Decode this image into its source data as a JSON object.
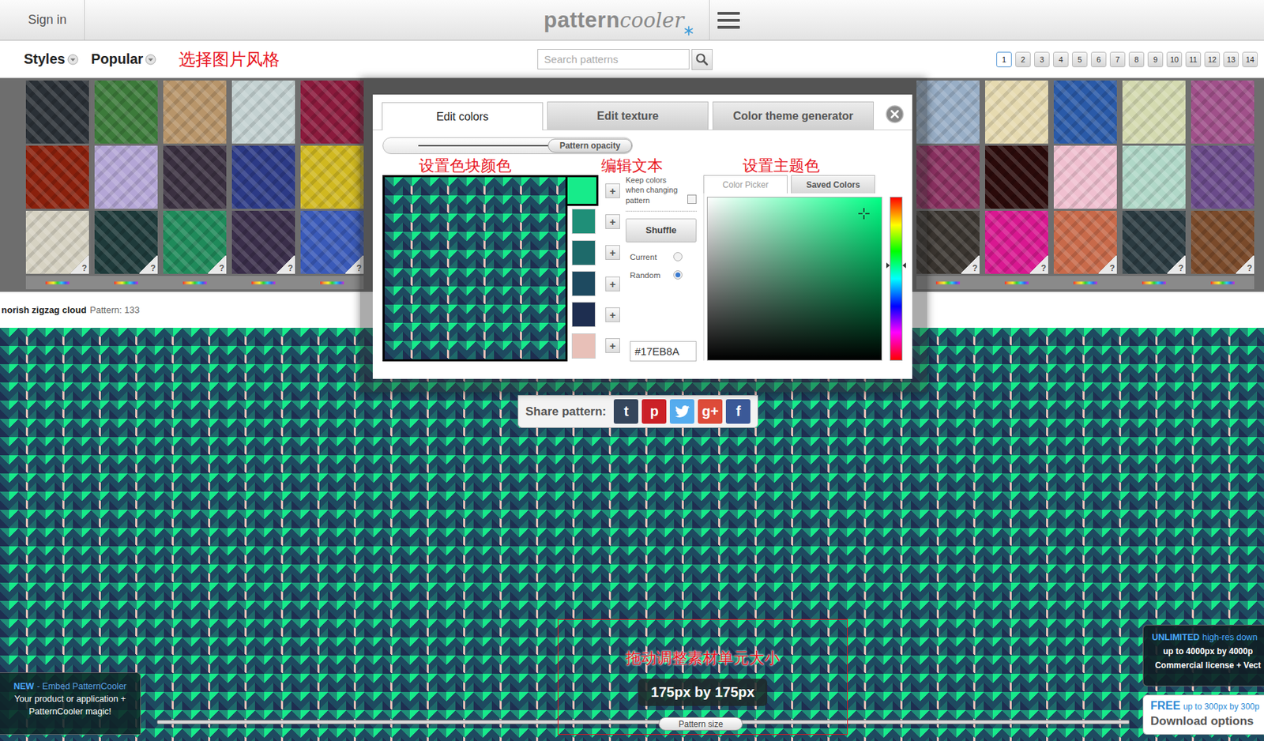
{
  "header": {
    "sign_in": "Sign in",
    "logo_left": "pattern",
    "logo_right": "cooler"
  },
  "menus": [
    {
      "label": "Styles"
    },
    {
      "label": "Popular"
    }
  ],
  "search": {
    "placeholder": "Search patterns"
  },
  "pages": [
    {
      "label": "1",
      "selected": true
    },
    {
      "label": "2",
      "selected": false
    },
    {
      "label": "3",
      "selected": false
    },
    {
      "label": "4",
      "selected": false
    },
    {
      "label": "5",
      "selected": false
    },
    {
      "label": "6",
      "selected": false
    },
    {
      "label": "7",
      "selected": false
    },
    {
      "label": "8",
      "selected": false
    },
    {
      "label": "9",
      "selected": false
    },
    {
      "label": "10",
      "selected": false
    },
    {
      "label": "11",
      "selected": false
    },
    {
      "label": "12",
      "selected": false
    },
    {
      "label": "13",
      "selected": false
    },
    {
      "label": "14",
      "selected": false
    }
  ],
  "thumbnails": {
    "left": [
      {
        "color": "#2a3036"
      },
      {
        "color": "#3c7a3a"
      },
      {
        "color": "#b8956a"
      },
      {
        "color": "#c4d2d2"
      },
      {
        "color": "#8a1a3c"
      },
      {
        "color": "#8a200c"
      },
      {
        "color": "#b4a6d6"
      },
      {
        "color": "#3a3040"
      },
      {
        "color": "#2c3a86"
      },
      {
        "color": "#d0b820"
      },
      {
        "color": "#d6d2c2",
        "badge": "?"
      },
      {
        "color": "#1e3a3a",
        "badge": "?"
      },
      {
        "color": "#1f8a5a",
        "badge": "?"
      },
      {
        "color": "#3a2e4a",
        "badge": "?"
      },
      {
        "color": "#3a5ab8",
        "badge": "?"
      }
    ],
    "right": [
      {
        "color": "#98aec6"
      },
      {
        "color": "#e6dab0"
      },
      {
        "color": "#2a5aa8"
      },
      {
        "color": "#d4dab0"
      },
      {
        "color": "#a0508a"
      },
      {
        "color": "#8a3060"
      },
      {
        "color": "#2a0a0a"
      },
      {
        "color": "#f0c0d0"
      },
      {
        "color": "#b0d8c8"
      },
      {
        "color": "#6a4a8a"
      },
      {
        "color": "#3a3530",
        "badge": "?"
      },
      {
        "color": "#d81890",
        "badge": "?"
      },
      {
        "color": "#c86a4a",
        "badge": "?"
      },
      {
        "color": "#2a3a40",
        "badge": "?"
      },
      {
        "color": "#7a4a2a",
        "badge": "?"
      }
    ]
  },
  "pattern_info": {
    "name": "norish zigzag cloud",
    "label": "Pattern: 133"
  },
  "modal": {
    "tabs": [
      {
        "label": "Edit colors",
        "selected": true
      },
      {
        "label": "Edit texture",
        "selected": false
      },
      {
        "label": "Color theme generator",
        "selected": false
      }
    ],
    "opacity": {
      "label": "Pattern opacity",
      "level": 1
    },
    "swatches": [
      {
        "color": "#17EB8A",
        "selected": true
      },
      {
        "color": "#1f8f78",
        "selected": false
      },
      {
        "color": "#1e6a6a",
        "selected": false
      },
      {
        "color": "#1e4a60",
        "selected": false
      },
      {
        "color": "#1e2e50",
        "selected": false
      },
      {
        "color": "#e8c0b8",
        "selected": false
      }
    ],
    "add": "+",
    "keep_colors": {
      "label": "Keep colors when changing pattern",
      "checked": false
    },
    "shuffle": "Shuffle",
    "modes": [
      {
        "label": "Current",
        "selected": false
      },
      {
        "label": "Random",
        "selected": true
      }
    ],
    "hex": "#17EB8A",
    "picker_tabs": [
      {
        "label": "Color Picker",
        "selected": true
      },
      {
        "label": "Saved Colors",
        "selected": false
      }
    ],
    "picker": {
      "hue": 0.42,
      "saturation": 0.9,
      "brightness": 0.9
    }
  },
  "annotations": {
    "styles": "选择图片风格",
    "swatches": "设置色块颜色",
    "text": "编辑文本",
    "theme": "设置主题色",
    "size": "拖动调整素材单元大小"
  },
  "share": {
    "label": "Share pattern:",
    "networks": [
      {
        "kind": "glyph",
        "glyph": "t",
        "color": "#35465c"
      },
      {
        "kind": "glyph",
        "glyph": "p",
        "color": "#cb2027"
      },
      {
        "kind": "bird",
        "color": "#55acee"
      },
      {
        "kind": "glyph",
        "glyph": "g+",
        "color": "#dd4b39"
      },
      {
        "kind": "glyph",
        "glyph": "f",
        "color": "#3b5998"
      }
    ]
  },
  "pattern_size": {
    "reading": "175px by 175px",
    "label": "Pattern size",
    "level": 0.56
  },
  "promo": {
    "badge": "NEW",
    "title": "- Embed PatternCooler",
    "lines": [
      "Your product or application +",
      "PatternCooler magic!"
    ]
  },
  "unlimited": {
    "badge": "UNLIMITED",
    "title": "high-res down",
    "lines": [
      "up to 4000px by 4000p",
      "Commercial license + Vect"
    ]
  },
  "free": {
    "badge": "FREE",
    "title": "up to 300px by 300p",
    "action": "Download options"
  }
}
